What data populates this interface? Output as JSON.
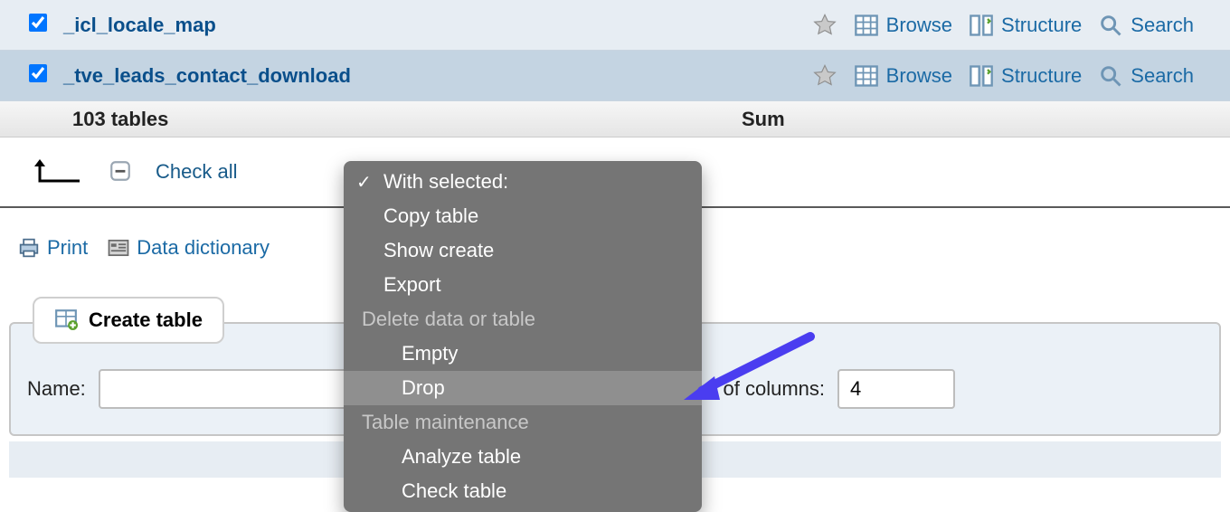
{
  "tables": [
    {
      "name": "_icl_locale_map",
      "checked": true
    },
    {
      "name": "_tve_leads_contact_download",
      "checked": true
    }
  ],
  "actions": {
    "browse": "Browse",
    "structure": "Structure",
    "search": "Search"
  },
  "summary": {
    "count_label": "103 tables",
    "sum_label": "Sum"
  },
  "checkall": {
    "label": "Check all"
  },
  "dropdown": {
    "header": "With selected:",
    "copy": "Copy table",
    "show_create": "Show create",
    "export": "Export",
    "group_delete": "Delete data or table",
    "empty": "Empty",
    "drop": "Drop",
    "group_maint": "Table maintenance",
    "analyze": "Analyze table",
    "check": "Check table"
  },
  "toolbar": {
    "print": "Print",
    "data_dictionary": "Data dictionary"
  },
  "create": {
    "button": "Create table",
    "name_label": "Name:",
    "name_value": "",
    "cols_label": "of columns:",
    "cols_value": "4"
  }
}
